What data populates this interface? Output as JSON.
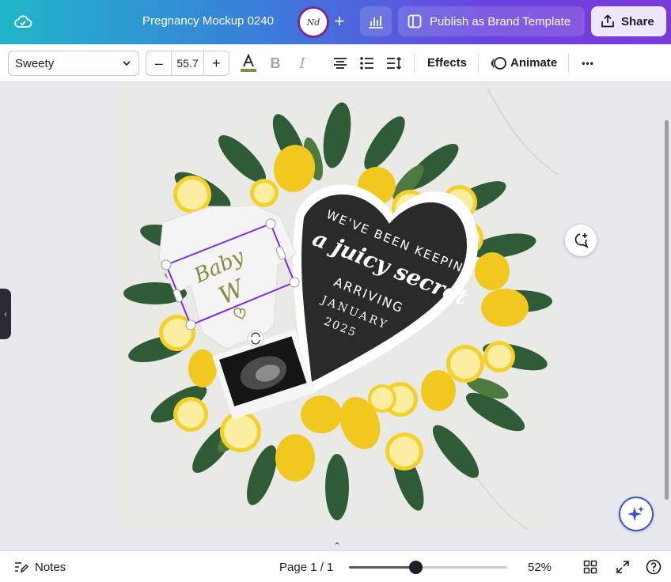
{
  "header": {
    "doc_title": "Pregnancy Mockup 0240",
    "avatar_text": "Nd",
    "publish_label": "Publish as Brand Template",
    "share_label": "Share"
  },
  "toolbar": {
    "font_name": "Sweety",
    "font_size": "55.7",
    "decrease_label": "–",
    "increase_label": "+",
    "bold_label": "B",
    "italic_label": "I",
    "effects_label": "Effects",
    "animate_label": "Animate",
    "more_label": "•••"
  },
  "design": {
    "onesie_line1": "Baby",
    "onesie_line2": "W",
    "board_line1": "WE'VE BEEN KEEPING",
    "board_line2": "a juicy secret",
    "board_line3": "ARRIVING",
    "board_line4": "JANUARY",
    "board_line5": "2025"
  },
  "footer": {
    "notes_label": "Notes",
    "page_indicator": "Page 1 / 1",
    "zoom_label": "52%",
    "zoom_fraction": 0.42
  },
  "colors": {
    "accent": "#7d2ae8",
    "board": "#2a2a2a",
    "lemon": "#f3d12a",
    "leaf": "#2f5b36",
    "text_olive": "#8a8a40"
  }
}
